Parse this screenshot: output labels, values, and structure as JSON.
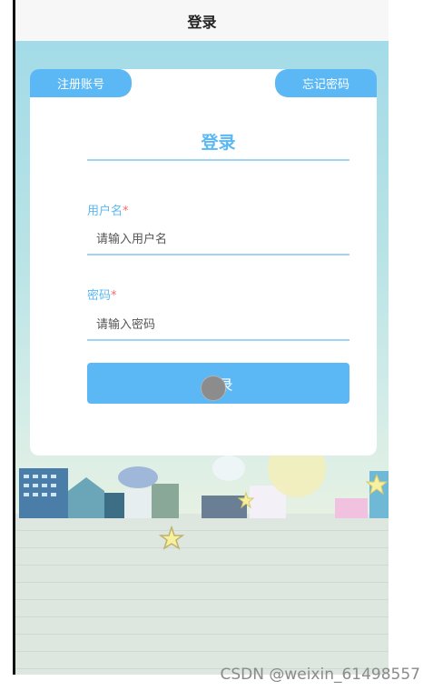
{
  "navbar": {
    "title": "登录"
  },
  "tabs": {
    "register": "注册账号",
    "forgot": "忘记密码"
  },
  "form": {
    "title": "登录",
    "username": {
      "label": "用户名",
      "required_mark": "*",
      "placeholder": "请输入用户名"
    },
    "password": {
      "label": "密码",
      "required_mark": "*",
      "placeholder": "请输入密码"
    },
    "submit_label": "登录"
  },
  "watermark": "CSDN @weixin_61498557",
  "colors": {
    "accent": "#5bb8f5",
    "underline": "#9fd4f4",
    "required": "#f56c6c"
  }
}
